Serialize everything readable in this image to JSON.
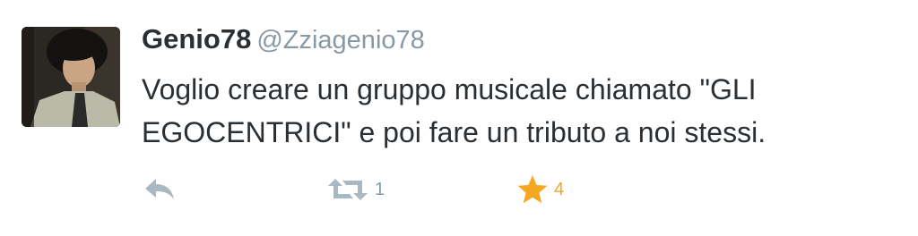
{
  "tweet": {
    "display_name": "Genio78",
    "handle": "@Zziagenio78",
    "text_line1": "Voglio creare un gruppo musicale chiamato \"GLI",
    "text_line2": "EGOCENTRICI\" e poi fare un tributo a noi stessi."
  },
  "actions": {
    "reply_icon": "reply-icon",
    "retweet_icon": "retweet-icon",
    "retweet_count": "1",
    "favorite_icon": "star-icon",
    "favorite_count": "4"
  },
  "colors": {
    "text": "#292f33",
    "secondary": "#8899a6",
    "favorite": "#f5a623",
    "icon_gray": "#aab8c2"
  }
}
